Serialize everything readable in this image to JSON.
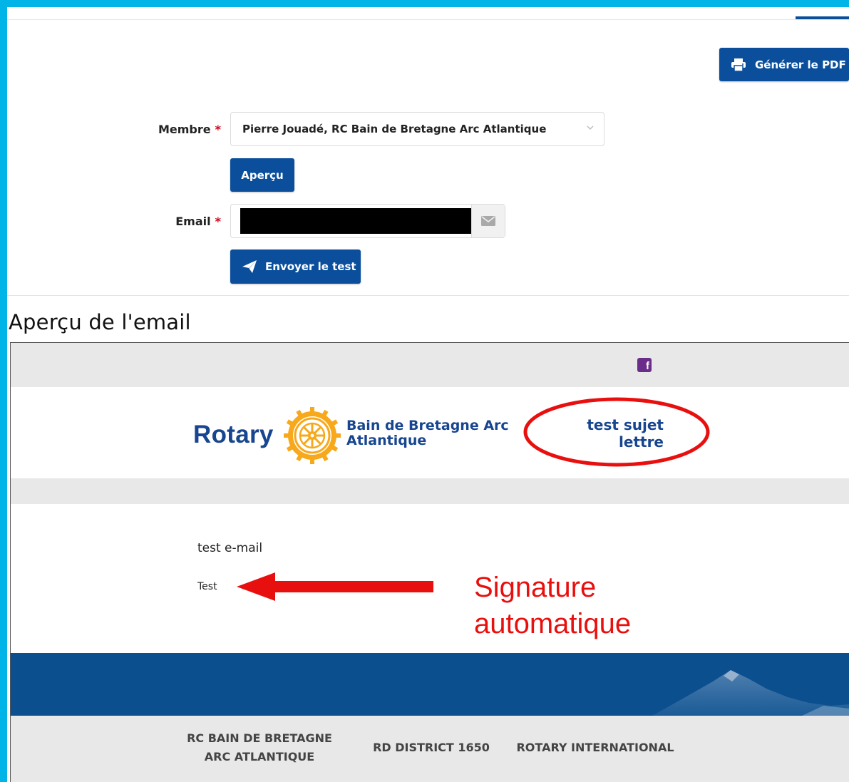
{
  "toolbar": {
    "generate_pdf_label": "Générer le PDF"
  },
  "form": {
    "member_label": "Membre",
    "member_value": "Pierre Jouadé, RC Bain de Bretagne Arc Atlantique",
    "preview_button": "Aperçu",
    "email_label": "Email",
    "required_mark": "*",
    "send_test_button": "Envoyer le test"
  },
  "preview": {
    "title": "Aperçu de l'email",
    "social_icon": "facebook-icon",
    "brand": "Rotary",
    "club_name_line1": "Bain de Bretagne Arc",
    "club_name_line2": "Atlantique",
    "subject_line1": "test sujet",
    "subject_line2": "lettre",
    "body_text": "test e-mail",
    "signature": "Test",
    "footer_links": [
      {
        "line1": "RC BAIN DE BRETAGNE",
        "line2": "ARC ATLANTIQUE"
      },
      {
        "line1": "RD DISTRICT 1650"
      },
      {
        "line1": "ROTARY INTERNATIONAL"
      }
    ]
  },
  "annotation": {
    "line1": "Signature",
    "line2": "automatique",
    "color": "#e8100e"
  },
  "colors": {
    "primary": "#0b4f9c",
    "rotary_blue": "#17458f",
    "rotary_gold": "#f7a81b",
    "required": "#d0021b",
    "frame_border": "#00b4e8"
  }
}
